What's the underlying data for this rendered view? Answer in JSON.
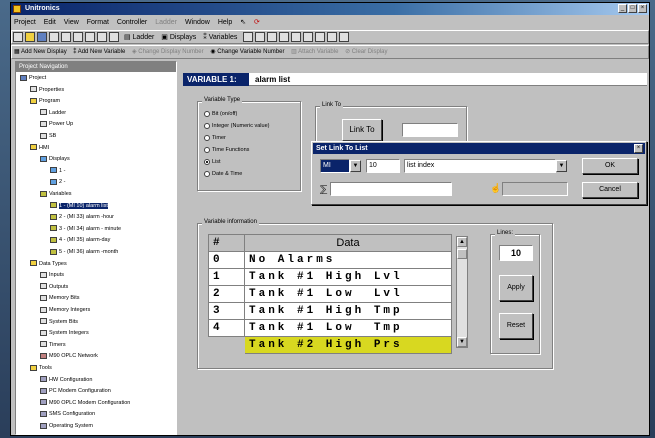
{
  "window": {
    "title": "Unitronics",
    "buttons": [
      "_",
      "□",
      "×"
    ]
  },
  "menu": [
    {
      "label": "Project",
      "enabled": true
    },
    {
      "label": "Edit",
      "enabled": true
    },
    {
      "label": "View",
      "enabled": true
    },
    {
      "label": "Format",
      "enabled": true
    },
    {
      "label": "Controller",
      "enabled": true
    },
    {
      "label": "Ladder",
      "enabled": false
    },
    {
      "label": "Window",
      "enabled": true
    },
    {
      "label": "Help",
      "enabled": true
    }
  ],
  "toolbar1": {
    "ladder": "Ladder",
    "displays": "Displays",
    "variables": "Variables"
  },
  "toolbar2": {
    "add_display": "Add New Display",
    "add_variable": "Add New Variable",
    "change_display_number": "Change Display Number",
    "change_variable_number": "Change Variable Number",
    "attach_variable": "Attach Variable",
    "clear_display": "Clear Display"
  },
  "nav": {
    "header": "Project Navigation",
    "items": [
      {
        "label": "Project",
        "indent": 0,
        "icon": "project"
      },
      {
        "label": "Properties",
        "indent": 1,
        "icon": "properties"
      },
      {
        "label": "Program",
        "indent": 1,
        "icon": "folder"
      },
      {
        "label": "Ladder",
        "indent": 2,
        "icon": "ladder"
      },
      {
        "label": "Power Up",
        "indent": 2,
        "icon": "powerup"
      },
      {
        "label": "SB",
        "indent": 2,
        "icon": "sb"
      },
      {
        "label": "HMI",
        "indent": 1,
        "icon": "folder"
      },
      {
        "label": "Displays",
        "indent": 2,
        "icon": "displays"
      },
      {
        "label": "1 -",
        "indent": 3,
        "icon": "display"
      },
      {
        "label": "2 -",
        "indent": 3,
        "icon": "display"
      },
      {
        "label": "Variables",
        "indent": 2,
        "icon": "variables"
      },
      {
        "label": "1 - (MI 10) alarm list",
        "indent": 3,
        "icon": "variable",
        "selected": true
      },
      {
        "label": "2 - (MI 33) alarm -hour",
        "indent": 3,
        "icon": "variable"
      },
      {
        "label": "3 - (MI 34) alarm - minute",
        "indent": 3,
        "icon": "variable"
      },
      {
        "label": "4 - (MI 35) alarm-day",
        "indent": 3,
        "icon": "variable"
      },
      {
        "label": "5 - (MI 36) alarm -month",
        "indent": 3,
        "icon": "variable"
      },
      {
        "label": "Data Types",
        "indent": 1,
        "icon": "folder"
      },
      {
        "label": "Inputs",
        "indent": 2,
        "icon": "datatype"
      },
      {
        "label": "Outputs",
        "indent": 2,
        "icon": "datatype"
      },
      {
        "label": "Memory Bits",
        "indent": 2,
        "icon": "datatype"
      },
      {
        "label": "Memory Integers",
        "indent": 2,
        "icon": "datatype"
      },
      {
        "label": "System Bits",
        "indent": 2,
        "icon": "datatype"
      },
      {
        "label": "System Integers",
        "indent": 2,
        "icon": "datatype"
      },
      {
        "label": "Timers",
        "indent": 2,
        "icon": "datatype"
      },
      {
        "label": "M90 OPLC Network",
        "indent": 2,
        "icon": "network"
      },
      {
        "label": "Tools",
        "indent": 1,
        "icon": "folder"
      },
      {
        "label": "HW Configuration",
        "indent": 2,
        "icon": "tool"
      },
      {
        "label": "PC Modem Configuration",
        "indent": 2,
        "icon": "tool"
      },
      {
        "label": "M90 OPLC Modem Configuration",
        "indent": 2,
        "icon": "tool"
      },
      {
        "label": "SMS Configuration",
        "indent": 2,
        "icon": "tool"
      },
      {
        "label": "Operating System",
        "indent": 2,
        "icon": "tool"
      }
    ]
  },
  "variable_header": {
    "label": "VARIABLE 1:",
    "name": "alarm list"
  },
  "variable_type": {
    "label": "Variable Type",
    "options": [
      {
        "label": "Bit (on/off)",
        "checked": false
      },
      {
        "label": "Integer (Numeric value)",
        "checked": false
      },
      {
        "label": "Timer",
        "checked": false
      },
      {
        "label": "Time Functions",
        "checked": false
      },
      {
        "label": "List",
        "checked": true
      },
      {
        "label": "Date & Time",
        "checked": false
      }
    ]
  },
  "link_to": {
    "label": "Link To",
    "button": "Link To",
    "value": ""
  },
  "dialog": {
    "title": "Set Link To List",
    "operand_type": "MI",
    "operand_number": "10",
    "description": "list index",
    "ok": "OK",
    "cancel": "Cancel"
  },
  "variable_info": {
    "label": "Variable information",
    "col_num": "#",
    "col_data": "Data",
    "rows": [
      {
        "num": "0",
        "data": "No Alarms"
      },
      {
        "num": "1",
        "data": "Tank #1 High Lvl"
      },
      {
        "num": "2",
        "data": "Tank #1 Low  Lvl"
      },
      {
        "num": "3",
        "data": "Tank #1 High Tmp"
      },
      {
        "num": "4",
        "data": "Tank #1 Low  Tmp"
      },
      {
        "num": "",
        "data": "Tank #2 High Prs"
      }
    ],
    "lines_label": "Lines:",
    "lines_value": "10",
    "apply": "Apply",
    "reset": "Reset"
  }
}
